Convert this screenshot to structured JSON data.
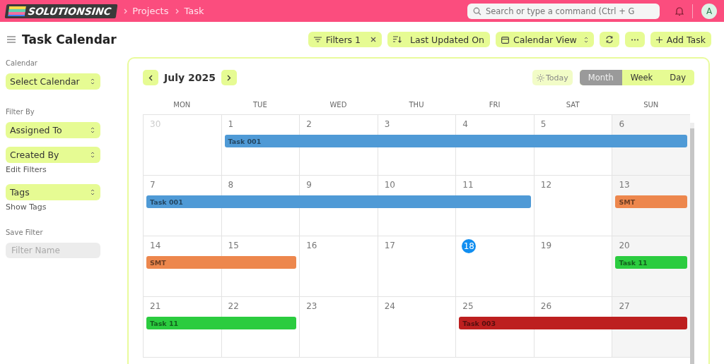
{
  "topbar": {
    "logo": "SOLUTIONSINC",
    "breadcrumbs": [
      "Projects",
      "Task"
    ],
    "search": {
      "placeholder": "Search or type a command (Ctrl + G"
    },
    "avatar": "A"
  },
  "header": {
    "title": "Task Calendar",
    "filters": {
      "label": "Filters 1"
    },
    "sort": {
      "label": "Last Updated On"
    },
    "view": {
      "label": "Calendar View"
    },
    "add": {
      "label": "Add Task"
    }
  },
  "sidebar": {
    "calendar_label": "Calendar",
    "calendar_select": "Select Calendar",
    "filter_label": "Filter By",
    "filter_selects": [
      "Assigned To",
      "Created By"
    ],
    "edit_filters": "Edit Filters",
    "tags_select": "Tags",
    "show_tags": "Show Tags",
    "save_label": "Save Filter",
    "filter_name": {
      "placeholder": "Filter Name"
    }
  },
  "calendar": {
    "month": "July 2025",
    "today": "Today",
    "views": [
      {
        "label": "Month",
        "selected": true
      },
      {
        "label": "Week",
        "selected": false
      },
      {
        "label": "Day",
        "selected": false
      }
    ],
    "weekdays": [
      "MON",
      "TUE",
      "WED",
      "THU",
      "FRI",
      "SAT",
      "SUN"
    ],
    "weeks": [
      {
        "days": [
          {
            "label": "30",
            "other_month": true,
            "today": false
          },
          {
            "label": "1",
            "other_month": false,
            "today": false
          },
          {
            "label": "2",
            "other_month": false,
            "today": false
          },
          {
            "label": "3",
            "other_month": false,
            "today": false
          },
          {
            "label": "4",
            "other_month": false,
            "today": false
          },
          {
            "label": "5",
            "other_month": false,
            "today": false
          },
          {
            "label": "6",
            "other_month": false,
            "today": false
          }
        ],
        "events": [
          {
            "title": "Task 001",
            "color": "#4f9ad6",
            "covers": [
              false,
              true,
              true,
              true,
              true,
              true,
              true
            ]
          }
        ]
      },
      {
        "days": [
          {
            "label": "7",
            "other_month": false,
            "today": false
          },
          {
            "label": "8",
            "other_month": false,
            "today": false
          },
          {
            "label": "9",
            "other_month": false,
            "today": false
          },
          {
            "label": "10",
            "other_month": false,
            "today": false
          },
          {
            "label": "11",
            "other_month": false,
            "today": false
          },
          {
            "label": "12",
            "other_month": false,
            "today": false
          },
          {
            "label": "13",
            "other_month": false,
            "today": false
          }
        ],
        "events": [
          {
            "title": "Task 001",
            "color": "#4f9ad6",
            "covers": [
              true,
              true,
              true,
              true,
              true,
              false,
              false
            ]
          },
          {
            "title": "SMT",
            "color": "#ed874d",
            "covers": [
              false,
              false,
              false,
              false,
              false,
              false,
              true
            ]
          }
        ]
      },
      {
        "days": [
          {
            "label": "14",
            "other_month": false,
            "today": false
          },
          {
            "label": "15",
            "other_month": false,
            "today": false
          },
          {
            "label": "16",
            "other_month": false,
            "today": false
          },
          {
            "label": "17",
            "other_month": false,
            "today": false
          },
          {
            "label": "18",
            "other_month": false,
            "today": true
          },
          {
            "label": "19",
            "other_month": false,
            "today": false
          },
          {
            "label": "20",
            "other_month": false,
            "today": false
          }
        ],
        "events": [
          {
            "title": "SMT",
            "color": "#ed874d",
            "covers": [
              true,
              true,
              false,
              false,
              false,
              false,
              false
            ]
          },
          {
            "title": "Task 11",
            "color": "#2bcc3f",
            "covers": [
              false,
              false,
              false,
              false,
              false,
              false,
              true
            ]
          }
        ]
      },
      {
        "days": [
          {
            "label": "21",
            "other_month": false,
            "today": false
          },
          {
            "label": "22",
            "other_month": false,
            "today": false
          },
          {
            "label": "23",
            "other_month": false,
            "today": false
          },
          {
            "label": "24",
            "other_month": false,
            "today": false
          },
          {
            "label": "25",
            "other_month": false,
            "today": false
          },
          {
            "label": "26",
            "other_month": false,
            "today": false
          },
          {
            "label": "27",
            "other_month": false,
            "today": false
          }
        ],
        "events": [
          {
            "title": "Task 11",
            "color": "#2bcc3f",
            "covers": [
              true,
              true,
              false,
              false,
              false,
              false,
              false
            ]
          },
          {
            "title": "Task 003",
            "color": "#bd1f1f",
            "covers": [
              false,
              false,
              false,
              false,
              true,
              true,
              true
            ]
          }
        ]
      }
    ]
  }
}
